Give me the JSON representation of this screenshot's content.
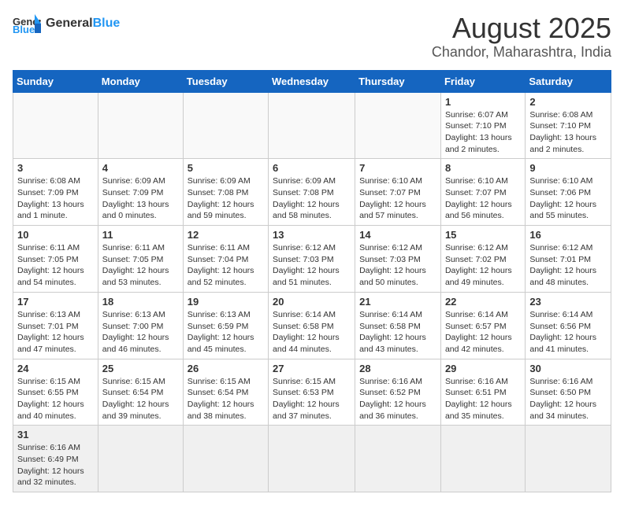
{
  "header": {
    "logo_general": "General",
    "logo_blue": "Blue",
    "title": "August 2025",
    "subtitle": "Chandor, Maharashtra, India"
  },
  "weekdays": [
    "Sunday",
    "Monday",
    "Tuesday",
    "Wednesday",
    "Thursday",
    "Friday",
    "Saturday"
  ],
  "weeks": [
    [
      {
        "day": "",
        "info": ""
      },
      {
        "day": "",
        "info": ""
      },
      {
        "day": "",
        "info": ""
      },
      {
        "day": "",
        "info": ""
      },
      {
        "day": "",
        "info": ""
      },
      {
        "day": "1",
        "info": "Sunrise: 6:07 AM\nSunset: 7:10 PM\nDaylight: 13 hours and 2 minutes."
      },
      {
        "day": "2",
        "info": "Sunrise: 6:08 AM\nSunset: 7:10 PM\nDaylight: 13 hours and 2 minutes."
      }
    ],
    [
      {
        "day": "3",
        "info": "Sunrise: 6:08 AM\nSunset: 7:09 PM\nDaylight: 13 hours and 1 minute."
      },
      {
        "day": "4",
        "info": "Sunrise: 6:09 AM\nSunset: 7:09 PM\nDaylight: 13 hours and 0 minutes."
      },
      {
        "day": "5",
        "info": "Sunrise: 6:09 AM\nSunset: 7:08 PM\nDaylight: 12 hours and 59 minutes."
      },
      {
        "day": "6",
        "info": "Sunrise: 6:09 AM\nSunset: 7:08 PM\nDaylight: 12 hours and 58 minutes."
      },
      {
        "day": "7",
        "info": "Sunrise: 6:10 AM\nSunset: 7:07 PM\nDaylight: 12 hours and 57 minutes."
      },
      {
        "day": "8",
        "info": "Sunrise: 6:10 AM\nSunset: 7:07 PM\nDaylight: 12 hours and 56 minutes."
      },
      {
        "day": "9",
        "info": "Sunrise: 6:10 AM\nSunset: 7:06 PM\nDaylight: 12 hours and 55 minutes."
      }
    ],
    [
      {
        "day": "10",
        "info": "Sunrise: 6:11 AM\nSunset: 7:05 PM\nDaylight: 12 hours and 54 minutes."
      },
      {
        "day": "11",
        "info": "Sunrise: 6:11 AM\nSunset: 7:05 PM\nDaylight: 12 hours and 53 minutes."
      },
      {
        "day": "12",
        "info": "Sunrise: 6:11 AM\nSunset: 7:04 PM\nDaylight: 12 hours and 52 minutes."
      },
      {
        "day": "13",
        "info": "Sunrise: 6:12 AM\nSunset: 7:03 PM\nDaylight: 12 hours and 51 minutes."
      },
      {
        "day": "14",
        "info": "Sunrise: 6:12 AM\nSunset: 7:03 PM\nDaylight: 12 hours and 50 minutes."
      },
      {
        "day": "15",
        "info": "Sunrise: 6:12 AM\nSunset: 7:02 PM\nDaylight: 12 hours and 49 minutes."
      },
      {
        "day": "16",
        "info": "Sunrise: 6:12 AM\nSunset: 7:01 PM\nDaylight: 12 hours and 48 minutes."
      }
    ],
    [
      {
        "day": "17",
        "info": "Sunrise: 6:13 AM\nSunset: 7:01 PM\nDaylight: 12 hours and 47 minutes."
      },
      {
        "day": "18",
        "info": "Sunrise: 6:13 AM\nSunset: 7:00 PM\nDaylight: 12 hours and 46 minutes."
      },
      {
        "day": "19",
        "info": "Sunrise: 6:13 AM\nSunset: 6:59 PM\nDaylight: 12 hours and 45 minutes."
      },
      {
        "day": "20",
        "info": "Sunrise: 6:14 AM\nSunset: 6:58 PM\nDaylight: 12 hours and 44 minutes."
      },
      {
        "day": "21",
        "info": "Sunrise: 6:14 AM\nSunset: 6:58 PM\nDaylight: 12 hours and 43 minutes."
      },
      {
        "day": "22",
        "info": "Sunrise: 6:14 AM\nSunset: 6:57 PM\nDaylight: 12 hours and 42 minutes."
      },
      {
        "day": "23",
        "info": "Sunrise: 6:14 AM\nSunset: 6:56 PM\nDaylight: 12 hours and 41 minutes."
      }
    ],
    [
      {
        "day": "24",
        "info": "Sunrise: 6:15 AM\nSunset: 6:55 PM\nDaylight: 12 hours and 40 minutes."
      },
      {
        "day": "25",
        "info": "Sunrise: 6:15 AM\nSunset: 6:54 PM\nDaylight: 12 hours and 39 minutes."
      },
      {
        "day": "26",
        "info": "Sunrise: 6:15 AM\nSunset: 6:54 PM\nDaylight: 12 hours and 38 minutes."
      },
      {
        "day": "27",
        "info": "Sunrise: 6:15 AM\nSunset: 6:53 PM\nDaylight: 12 hours and 37 minutes."
      },
      {
        "day": "28",
        "info": "Sunrise: 6:16 AM\nSunset: 6:52 PM\nDaylight: 12 hours and 36 minutes."
      },
      {
        "day": "29",
        "info": "Sunrise: 6:16 AM\nSunset: 6:51 PM\nDaylight: 12 hours and 35 minutes."
      },
      {
        "day": "30",
        "info": "Sunrise: 6:16 AM\nSunset: 6:50 PM\nDaylight: 12 hours and 34 minutes."
      }
    ],
    [
      {
        "day": "31",
        "info": "Sunrise: 6:16 AM\nSunset: 6:49 PM\nDaylight: 12 hours and 32 minutes."
      },
      {
        "day": "",
        "info": ""
      },
      {
        "day": "",
        "info": ""
      },
      {
        "day": "",
        "info": ""
      },
      {
        "day": "",
        "info": ""
      },
      {
        "day": "",
        "info": ""
      },
      {
        "day": "",
        "info": ""
      }
    ]
  ]
}
